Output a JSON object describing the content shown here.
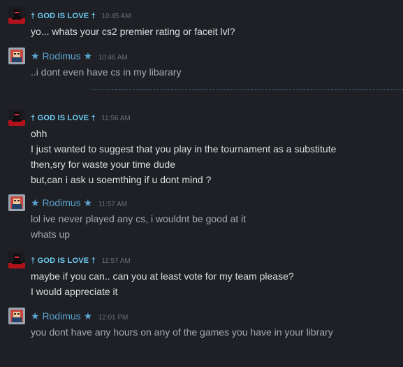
{
  "users": {
    "god": {
      "name": "† GOD IS LOVE †",
      "color": "#6dcff6"
    },
    "rod": {
      "name": "★ Rodimus ★",
      "color": "#5ba3d0"
    }
  },
  "messages": [
    {
      "sender": "† GOD IS LOVE †",
      "time": "10:45 AM",
      "lines": [
        "yo... whats your cs2 premier rating or faceit lvl?"
      ]
    },
    {
      "sender": "★ Rodimus ★",
      "time": "10:46 AM",
      "lines": [
        "..i dont even have cs in my libarary"
      ]
    },
    {
      "sender": "† GOD IS LOVE †",
      "time": "11:56 AM",
      "lines": [
        "ohh",
        "I just wanted to suggest that you play in the tournament as a substitute",
        "then,sry for waste your time dude",
        "but,can i ask u soemthing if u dont mind ?"
      ]
    },
    {
      "sender": "★ Rodimus ★",
      "time": "11:57 AM",
      "lines": [
        "lol ive never played any cs, i wouldnt be good at it",
        "whats up"
      ]
    },
    {
      "sender": "† GOD IS LOVE †",
      "time": "11:57 AM",
      "lines": [
        "maybe if you can.. can you at least vote for my team please?",
        "I would appreciate it"
      ]
    },
    {
      "sender": "★ Rodimus ★",
      "time": "12:01 PM",
      "lines": [
        "you dont have any hours on any of the games you have in your library"
      ]
    }
  ]
}
